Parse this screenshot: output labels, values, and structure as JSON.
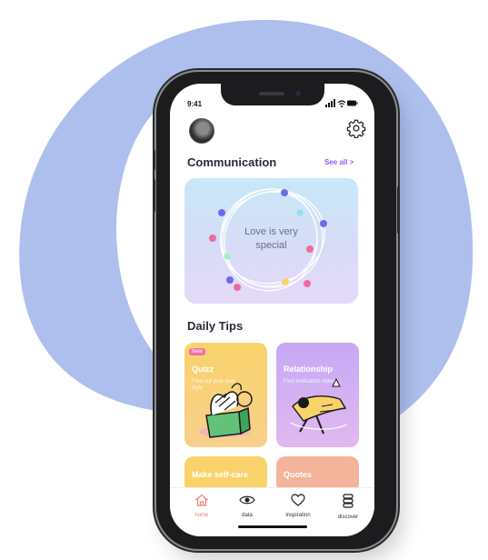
{
  "status_bar": {
    "time": "9:41"
  },
  "header": {
    "avatar": "profile-photo",
    "settings_icon": "gear-icon"
  },
  "communication": {
    "title": "Communication",
    "see_all": "See all >",
    "card_text_line1": "Love is very",
    "card_text_line2": "special"
  },
  "daily_tips": {
    "title": "Daily Tips",
    "cards": [
      {
        "badge": "New",
        "title": "Quizz",
        "subtitle": "Find out your love style"
      },
      {
        "title": "Relationship",
        "subtitle": "Find motivation videos"
      },
      {
        "title": "Make self-care"
      },
      {
        "title": "Quotes"
      }
    ]
  },
  "tabbar": {
    "items": [
      {
        "label": "home",
        "icon": "home-icon",
        "active": true
      },
      {
        "label": "data",
        "icon": "eye-icon"
      },
      {
        "label": "inspiration",
        "icon": "heart-icon"
      },
      {
        "label": "discover",
        "icon": "stack-icon"
      }
    ]
  },
  "colors": {
    "background_ring": "#aebfee",
    "accent_purple": "#8e5cf0",
    "active_tab": "#f1806b",
    "quiz_card": "#f8d36a",
    "relationship_card": "#c9a8f5",
    "selfcare_card": "#f8d36a",
    "quotes_card": "#f4b39b"
  }
}
